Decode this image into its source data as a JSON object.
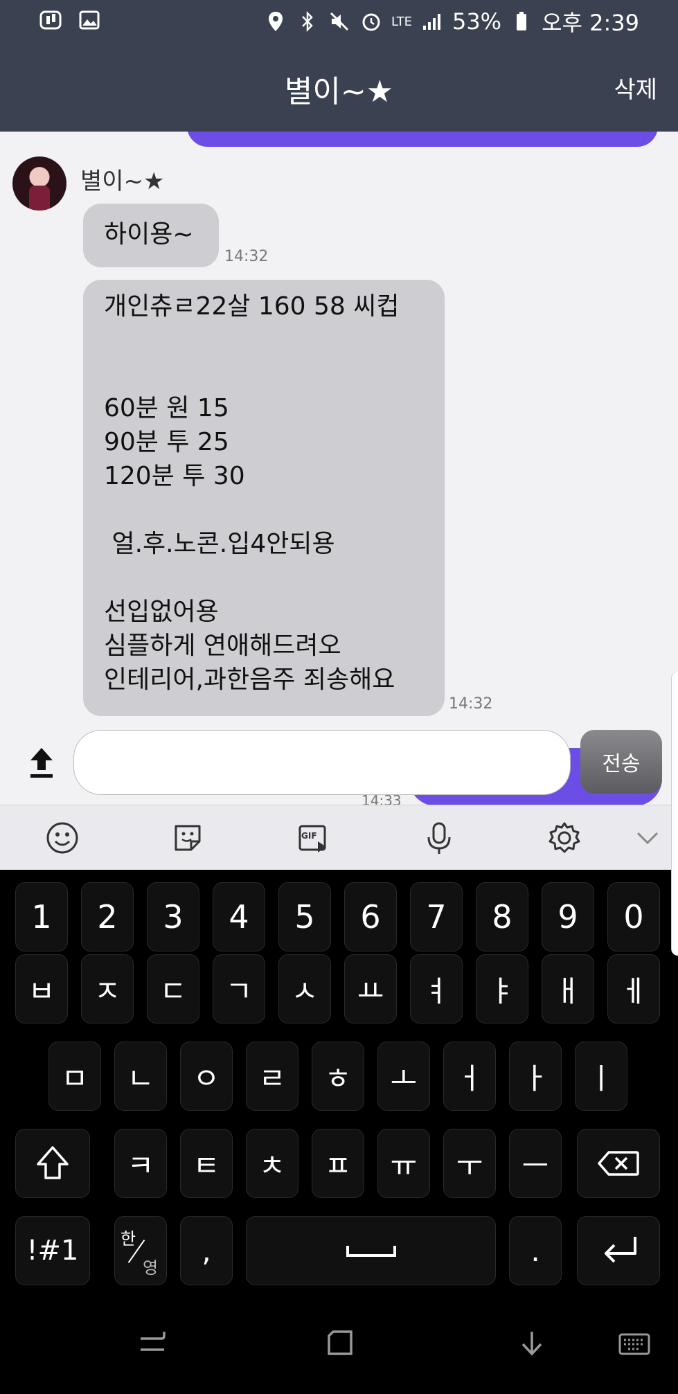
{
  "status_bar": {
    "battery": "53%",
    "network": "LTE",
    "time": "오후 2:39"
  },
  "app_bar": {
    "title": "별이~★",
    "action": "삭제"
  },
  "chat": {
    "sender_name": "별이~★",
    "messages": [
      {
        "lines": [
          "하이용~"
        ],
        "time": "14:32"
      },
      {
        "lines": [
          "개인츄ㄹ22살 160 58 씨컵",
          "",
          "",
          "60분 원 15",
          "90분 투 25",
          "120분 투 30",
          "",
          " 얼.후.노콘.입4안되용",
          "",
          "선입없어용",
          "심플하게 연애해드려오",
          "인테리어,과한음주 죄송해요"
        ],
        "time": "14:32"
      }
    ],
    "partial_time": "14:33"
  },
  "input": {
    "value": "",
    "placeholder": "",
    "send_label": "전송"
  },
  "keyboard": {
    "row1": [
      "1",
      "2",
      "3",
      "4",
      "5",
      "6",
      "7",
      "8",
      "9",
      "0"
    ],
    "row2": [
      "ㅂ",
      "ㅈ",
      "ㄷ",
      "ㄱ",
      "ㅅ",
      "ㅛ",
      "ㅕ",
      "ㅑ",
      "ㅐ",
      "ㅔ"
    ],
    "row3": [
      "ㅁ",
      "ㄴ",
      "ㅇ",
      "ㄹ",
      "ㅎ",
      "ㅗ",
      "ㅓ",
      "ㅏ",
      "ㅣ"
    ],
    "row4": [
      "ㅋ",
      "ㅌ",
      "ㅊ",
      "ㅍ",
      "ㅠ",
      "ㅜ",
      "ㅡ"
    ],
    "symbols_label": "!#1",
    "lang_top": "한",
    "lang_bottom": "영",
    "comma": ",",
    "period": "."
  },
  "toolbar": {
    "gif_label": "GIF"
  },
  "colors": {
    "header": "#3a4150",
    "accent": "#6c4ee6",
    "bubble": "#cdcdd2",
    "keyboard": "#000000"
  }
}
